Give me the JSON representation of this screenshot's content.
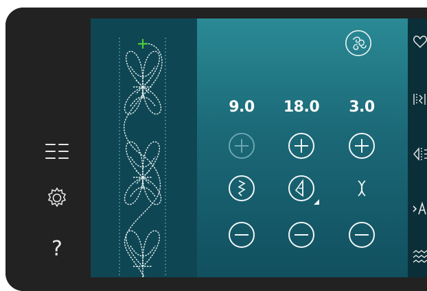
{
  "left_rail": {
    "menu_icon": "list-menu-icon",
    "settings_icon": "gear-icon",
    "help_label": "?"
  },
  "stitch_preview": {
    "pattern": "butterfly-quilt-stitch",
    "start_marker": "green-cross"
  },
  "controls": {
    "top_icon": "stitch-swirl-icon",
    "columns": [
      {
        "value": "9.0",
        "plus_enabled": false,
        "mode_icon": "stitch-width-icon"
      },
      {
        "value": "18.0",
        "plus_enabled": true,
        "mode_icon": "stitch-positioning-icon"
      },
      {
        "value": "3.0",
        "plus_enabled": true,
        "mode_icon": "mirror-icon"
      }
    ]
  },
  "right_bar": {
    "icons": [
      "favorite-heart-icon",
      "tie-off-icon",
      "side-mirror-icon",
      "text-stitch-icon",
      "stitch-menu-icon"
    ]
  },
  "colors": {
    "accent": "#2a8a95",
    "stitch": "#e6f0f0",
    "marker": "#4ecb3b"
  }
}
